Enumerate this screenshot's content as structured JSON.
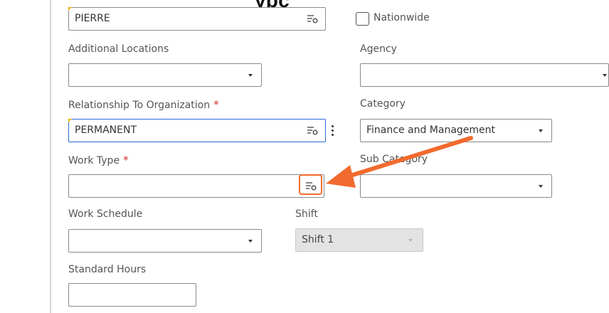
{
  "page": {
    "heading_fragment": "ypc                                        p    g"
  },
  "fields": {
    "location": {
      "value": "PIERRE",
      "icon": "lookup-list-icon"
    },
    "nationwide": {
      "label": "Nationwide",
      "checked": false
    },
    "additional_locations": {
      "label": "Additional Locations",
      "value": ""
    },
    "agency": {
      "label": "Agency",
      "value": ""
    },
    "relationship": {
      "label": "Relationship To Organization",
      "required_mark": "*",
      "value": "PERMANENT",
      "icon": "lookup-list-icon"
    },
    "category": {
      "label": "Category",
      "value": "Finance and Management"
    },
    "work_type": {
      "label": "Work Type",
      "required_mark": "*",
      "value": "",
      "icon": "lookup-list-icon"
    },
    "sub_category": {
      "label": "Sub Category",
      "value": ""
    },
    "work_schedule": {
      "label": "Work Schedule",
      "value": ""
    },
    "shift": {
      "label": "Shift",
      "value": "Shift 1",
      "disabled": true
    },
    "standard_hours": {
      "label": "Standard Hours",
      "value": ""
    }
  },
  "annotation": {
    "color": "#f26a2e",
    "target": "work-type lookup icon"
  },
  "colors": {
    "required": "#d32f2f",
    "focus": "#2a6bd6",
    "marker": "#f2b400"
  }
}
